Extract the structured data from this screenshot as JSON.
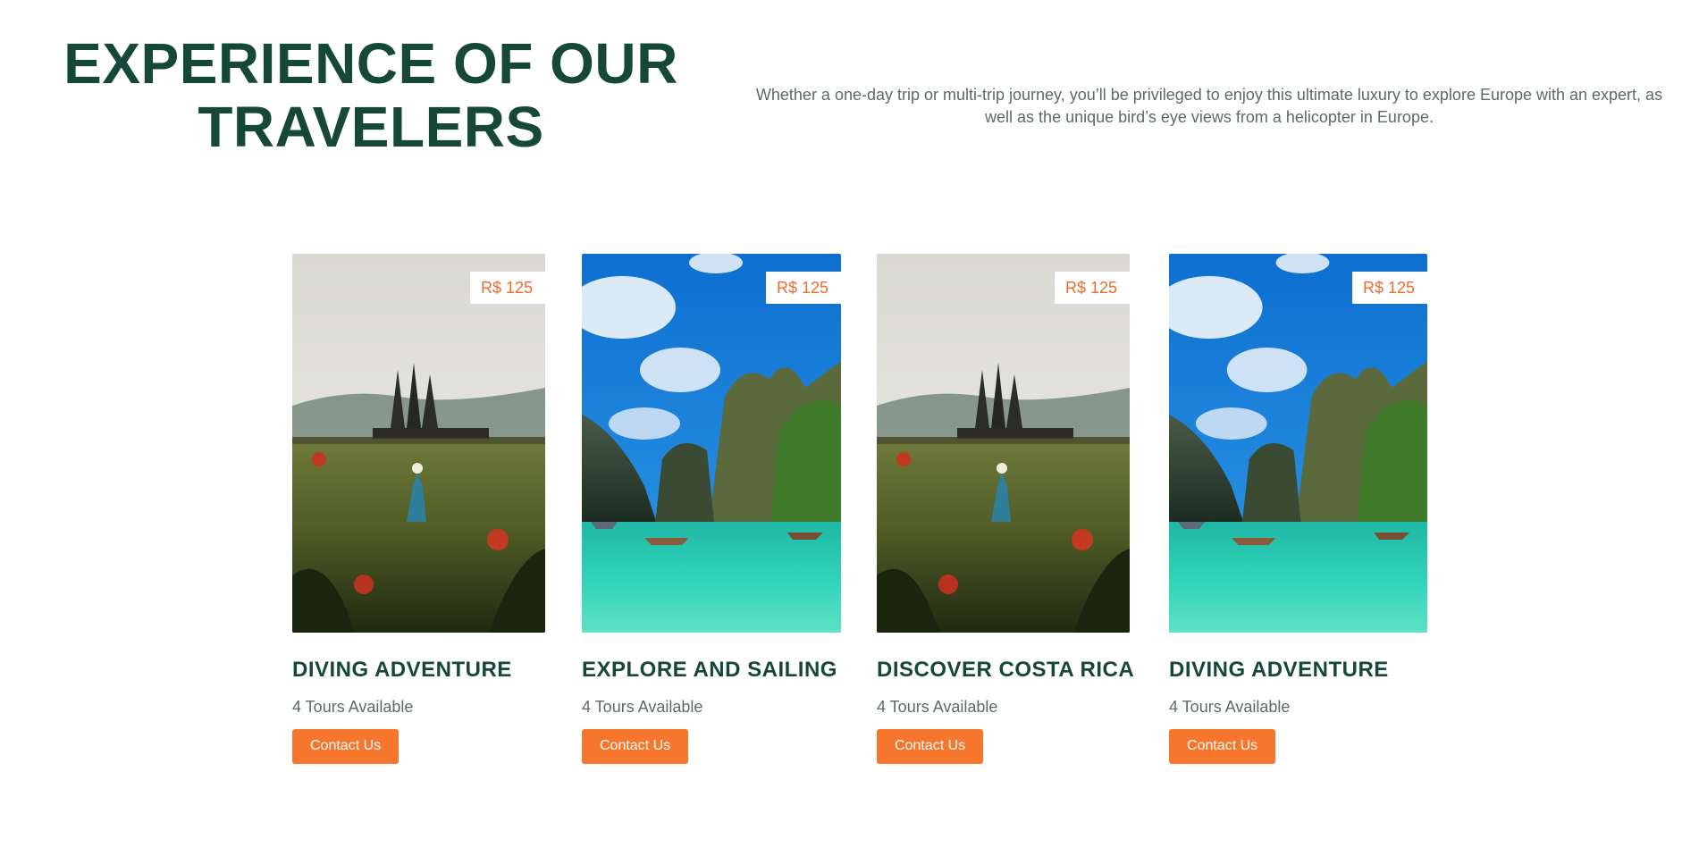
{
  "header": {
    "title_line1": "EXPERIENCE OF OUR",
    "title_line2": "TRAVELERS",
    "description": "Whether a one-day trip or multi-trip journey, you’ll be privileged to enjoy this ultimate luxury to explore Europe with an expert, as well as the unique bird’s eye views from a helicopter in Europe."
  },
  "colors": {
    "heading": "#16483a",
    "accent": "#f5762c",
    "price": "#ef6b2a",
    "muted_text": "#5b6b68"
  },
  "cards": [
    {
      "image": "temple-meadow-photo",
      "price": "R$ 125",
      "title": "DIVING ADVENTURE",
      "subtitle": "4 Tours Available",
      "button": "Contact Us"
    },
    {
      "image": "tropical-lagoon-photo",
      "price": "R$ 125",
      "title": "EXPLORE AND SAILING",
      "subtitle": "4 Tours Available",
      "button": "Contact Us"
    },
    {
      "image": "temple-meadow-photo",
      "price": "R$ 125",
      "title": "DISCOVER COSTA RICA",
      "subtitle": "4 Tours Available",
      "button": "Contact Us"
    },
    {
      "image": "tropical-lagoon-photo",
      "price": "R$ 125",
      "title": "DIVING ADVENTURE",
      "subtitle": "4 Tours Available",
      "button": "Contact Us"
    }
  ]
}
